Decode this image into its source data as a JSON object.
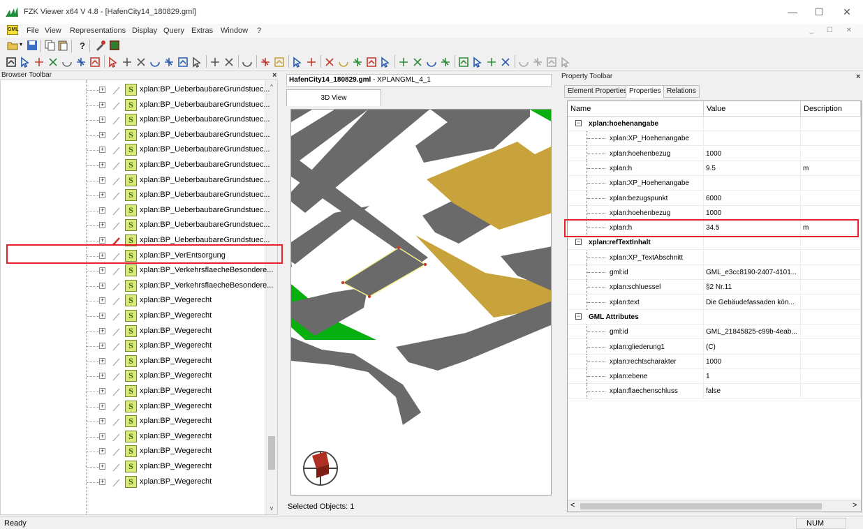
{
  "window": {
    "title": "FZK Viewer x64 V 4.8 - [HafenCity14_180829.gml]",
    "min": "—",
    "max": "☐",
    "close": "✕"
  },
  "menu": {
    "gml_icon": "GML",
    "items": [
      "File",
      "View",
      "Representations",
      "Display",
      "Query",
      "Extras",
      "Window",
      "?"
    ],
    "mdi": "_ ☐ ✕"
  },
  "browser": {
    "title": "Browser Toolbar",
    "close": "×",
    "rows": [
      {
        "label": "xplan:BP_UeberbaubareGrundstuec...",
        "selected": false
      },
      {
        "label": "xplan:BP_UeberbaubareGrundstuec...",
        "selected": false
      },
      {
        "label": "xplan:BP_UeberbaubareGrundstuec...",
        "selected": false
      },
      {
        "label": "xplan:BP_UeberbaubareGrundstuec...",
        "selected": false
      },
      {
        "label": "xplan:BP_UeberbaubareGrundstuec...",
        "selected": false
      },
      {
        "label": "xplan:BP_UeberbaubareGrundstuec...",
        "selected": false
      },
      {
        "label": "xplan:BP_UeberbaubareGrundstuec...",
        "selected": false
      },
      {
        "label": "xplan:BP_UeberbaubareGrundstuec...",
        "selected": false
      },
      {
        "label": "xplan:BP_UeberbaubareGrundstuec...",
        "selected": false
      },
      {
        "label": "xplan:BP_UeberbaubareGrundstuec...",
        "selected": false
      },
      {
        "label": "xplan:BP_UeberbaubareGrundstuec...",
        "selected": true
      },
      {
        "label": "xplan:BP_VerEntsorgung",
        "selected": false
      },
      {
        "label": "xplan:BP_VerkehrsflaecheBesondere...",
        "selected": false
      },
      {
        "label": "xplan:BP_VerkehrsflaecheBesondere...",
        "selected": false
      },
      {
        "label": "xplan:BP_Wegerecht",
        "selected": false
      },
      {
        "label": "xplan:BP_Wegerecht",
        "selected": false
      },
      {
        "label": "xplan:BP_Wegerecht",
        "selected": false
      },
      {
        "label": "xplan:BP_Wegerecht",
        "selected": false
      },
      {
        "label": "xplan:BP_Wegerecht",
        "selected": false
      },
      {
        "label": "xplan:BP_Wegerecht",
        "selected": false
      },
      {
        "label": "xplan:BP_Wegerecht",
        "selected": false
      },
      {
        "label": "xplan:BP_Wegerecht",
        "selected": false
      },
      {
        "label": "xplan:BP_Wegerecht",
        "selected": false
      },
      {
        "label": "xplan:BP_Wegerecht",
        "selected": false
      },
      {
        "label": "xplan:BP_Wegerecht",
        "selected": false
      },
      {
        "label": "xplan:BP_Wegerecht",
        "selected": false
      },
      {
        "label": "xplan:BP_Wegerecht",
        "selected": false
      }
    ],
    "scroll_up": "^",
    "scroll_down": "v"
  },
  "view": {
    "doc_file": "HafenCity14_180829.gml",
    "doc_schema": " - XPLANGML_4_1",
    "tab": "3D View",
    "selected_objects": "Selected Objects: 1",
    "colors": {
      "grey": "#6a6a6a",
      "green": "#08b00f",
      "ochre": "#c8a23b",
      "white": "#ffffff"
    }
  },
  "props": {
    "title": "Property Toolbar",
    "close": "×",
    "tabs": [
      "Element Properties",
      "Properties",
      "Relations"
    ],
    "active_tab": 1,
    "columns": [
      "Name",
      "Value",
      "Description"
    ],
    "rows": [
      {
        "kind": "group",
        "name": "xplan:hoehenangabe",
        "value": "",
        "desc": ""
      },
      {
        "kind": "child",
        "name": "xplan:XP_Hoehenangabe",
        "value": "",
        "desc": ""
      },
      {
        "kind": "child",
        "name": "xplan:hoehenbezug",
        "value": "1000",
        "desc": ""
      },
      {
        "kind": "child",
        "name": "xplan:h",
        "value": "9.5",
        "desc": "m"
      },
      {
        "kind": "child",
        "name": "xplan:XP_Hoehenangabe",
        "value": "",
        "desc": ""
      },
      {
        "kind": "child",
        "name": "xplan:bezugspunkt",
        "value": "6000",
        "desc": ""
      },
      {
        "kind": "child",
        "name": "xplan:hoehenbezug",
        "value": "1000",
        "desc": ""
      },
      {
        "kind": "child",
        "name": "xplan:h",
        "value": "34.5",
        "desc": "m"
      },
      {
        "kind": "group",
        "name": "xplan:refTextInhalt",
        "value": "",
        "desc": ""
      },
      {
        "kind": "child",
        "name": "xplan:XP_TextAbschnitt",
        "value": "",
        "desc": ""
      },
      {
        "kind": "child",
        "name": "gml:id",
        "value": "GML_e3cc8190-2407-4101...",
        "desc": ""
      },
      {
        "kind": "child",
        "name": "xplan:schluessel",
        "value": "§2 Nr.11",
        "desc": ""
      },
      {
        "kind": "child",
        "name": "xplan:text",
        "value": "Die Gebäudefassaden kön...",
        "desc": ""
      },
      {
        "kind": "group",
        "name": "GML Attributes",
        "value": "",
        "desc": ""
      },
      {
        "kind": "child",
        "name": "gml:id",
        "value": "GML_21845825-c99b-4eab...",
        "desc": ""
      },
      {
        "kind": "child",
        "name": "xplan:gliederung1",
        "value": "(C)",
        "desc": ""
      },
      {
        "kind": "child",
        "name": "xplan:rechtscharakter",
        "value": "1000",
        "desc": ""
      },
      {
        "kind": "child",
        "name": "xplan:ebene",
        "value": "1",
        "desc": ""
      },
      {
        "kind": "child",
        "name": "xplan:flaechenschluss",
        "value": "false",
        "desc": ""
      }
    ],
    "scroll_left": "<",
    "scroll_right": ">"
  },
  "status": {
    "ready": "Ready",
    "num": "NUM"
  },
  "accent": {
    "highlight": "#e8202a"
  }
}
